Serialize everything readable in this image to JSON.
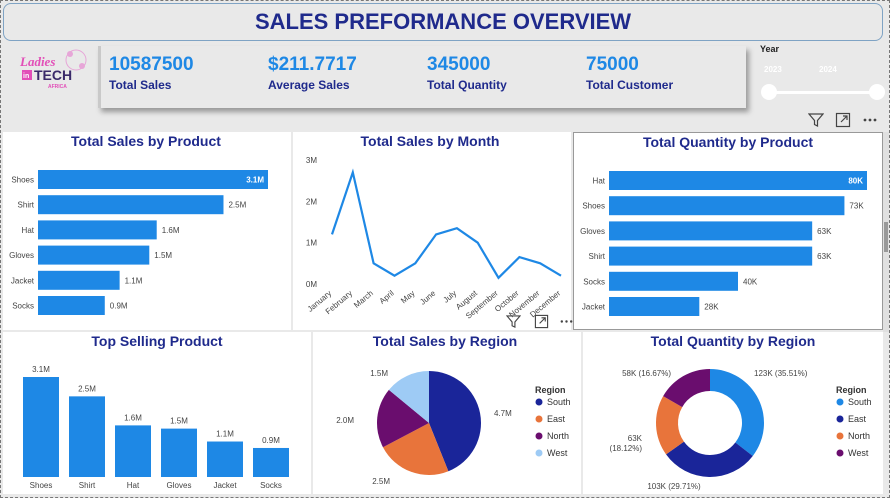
{
  "header": {
    "title": "SALES PREFORMANCE OVERVIEW"
  },
  "logo": {
    "line1": "Ladies",
    "line2": "in",
    "line3": "TECH",
    "line4": "AFRICA"
  },
  "kpis": [
    {
      "value": "10587500",
      "label": "Total Sales"
    },
    {
      "value": "$211.7717",
      "label": "Average Sales"
    },
    {
      "value": "345000",
      "label": "Total Quantity"
    },
    {
      "value": "75000",
      "label": "Total Customer"
    }
  ],
  "slicer": {
    "title": "Year",
    "start": "2023",
    "end": "2024"
  },
  "colors": {
    "blue": "#1e88e5",
    "navy": "#1a2599",
    "orange": "#e8743b",
    "purple": "#6a0d6e",
    "light": "#9ecbf5",
    "titleNavy": "#1f2a8c"
  },
  "icons": {
    "filter": "filter-icon",
    "focus": "focus-mode-icon",
    "more": "more-options-icon"
  },
  "chart_data": [
    {
      "id": "sales_by_product",
      "type": "bar",
      "orientation": "horizontal",
      "title": "Total Sales by Product",
      "categories": [
        "Shoes",
        "Shirt",
        "Hat",
        "Gloves",
        "Jacket",
        "Socks"
      ],
      "values": [
        3100000,
        2500000,
        1600000,
        1500000,
        1100000,
        900000
      ],
      "data_labels": [
        "3.1M",
        "2.5M",
        "1.6M",
        "1.5M",
        "1.1M",
        "0.9M"
      ],
      "color": "#1e88e5"
    },
    {
      "id": "sales_by_month",
      "type": "line",
      "title": "Total Sales by Month",
      "x": [
        "January",
        "February",
        "March",
        "April",
        "May",
        "June",
        "July",
        "August",
        "September",
        "October",
        "November",
        "December"
      ],
      "values": [
        1200000,
        2700000,
        500000,
        200000,
        500000,
        1200000,
        1350000,
        1000000,
        150000,
        650000,
        500000,
        200000
      ],
      "yticks": [
        "0M",
        "1M",
        "2M",
        "3M"
      ],
      "ylim": [
        0,
        3000000
      ],
      "color": "#1e88e5"
    },
    {
      "id": "quantity_by_product",
      "type": "bar",
      "orientation": "horizontal",
      "title": "Total Quantity by Product",
      "categories": [
        "Hat",
        "Shoes",
        "Gloves",
        "Shirt",
        "Socks",
        "Jacket"
      ],
      "values": [
        80000,
        73000,
        63000,
        63000,
        40000,
        28000
      ],
      "data_labels": [
        "80K",
        "73K",
        "63K",
        "63K",
        "40K",
        "28K"
      ],
      "color": "#1e88e5"
    },
    {
      "id": "top_selling_product",
      "type": "bar",
      "orientation": "vertical",
      "title": "Top Selling Product",
      "categories": [
        "Shoes",
        "Shirt",
        "Hat",
        "Gloves",
        "Jacket",
        "Socks"
      ],
      "values": [
        3100000,
        2500000,
        1600000,
        1500000,
        1100000,
        900000
      ],
      "data_labels": [
        "3.1M",
        "2.5M",
        "1.6M",
        "1.5M",
        "1.1M",
        "0.9M"
      ],
      "color": "#1e88e5"
    },
    {
      "id": "sales_by_region",
      "type": "pie",
      "title": "Total Sales by Region",
      "legend_title": "Region",
      "slices": [
        {
          "name": "South",
          "value": 4700000,
          "label": "4.7M",
          "color": "#1a2599"
        },
        {
          "name": "East",
          "value": 2500000,
          "label": "2.5M",
          "color": "#e8743b"
        },
        {
          "name": "North",
          "value": 2000000,
          "label": "2.0M",
          "color": "#6a0d6e"
        },
        {
          "name": "West",
          "value": 1500000,
          "label": "1.5M",
          "color": "#9ecbf5"
        }
      ]
    },
    {
      "id": "quantity_by_region",
      "type": "pie",
      "donut": true,
      "title": "Total Quantity by Region",
      "legend_title": "Region",
      "slices": [
        {
          "name": "South",
          "value": 123000,
          "label": "123K (35.51%)",
          "color": "#1e88e5"
        },
        {
          "name": "East",
          "value": 103000,
          "label": "103K (29.71%)",
          "color": "#1a2599"
        },
        {
          "name": "North",
          "value": 63000,
          "label": "63K (18.12%)",
          "color": "#e8743b"
        },
        {
          "name": "West",
          "value": 58000,
          "label": "58K (16.67%)",
          "color": "#6a0d6e"
        }
      ]
    }
  ]
}
